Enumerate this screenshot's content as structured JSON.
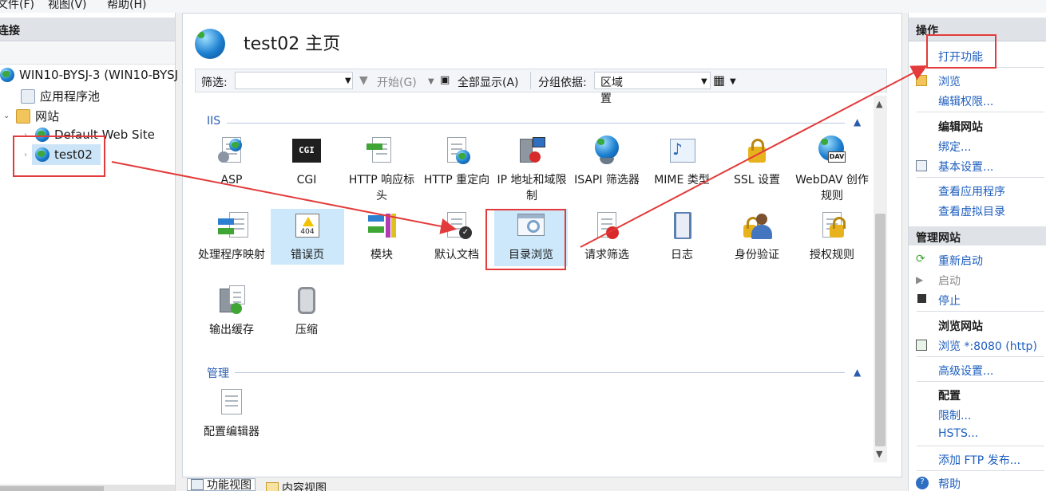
{
  "menu": {
    "items": [
      "文件(F)",
      "视图(V)",
      "帮助(H)"
    ]
  },
  "connections": {
    "header": "连接",
    "tree": {
      "server": "WIN10-BYSJ-3 (WIN10-BYSJ",
      "app_pools": "应用程序池",
      "sites": "网站",
      "default_site": "Default Web Site",
      "selected_site": "test02"
    }
  },
  "center": {
    "title": "test02 主页",
    "filter": {
      "label": "筛选:",
      "start": "开始(G)",
      "show_all": "全部显示(A)",
      "group_by_label": "分组依据:",
      "group_by_value": "区域",
      "overflow": "置"
    },
    "groups": {
      "iis": "IIS",
      "manage": "管理"
    },
    "features": [
      {
        "label": "ASP"
      },
      {
        "label": "CGI"
      },
      {
        "label": "HTTP 响应标头"
      },
      {
        "label": "HTTP 重定向"
      },
      {
        "label": "IP 地址和域限制"
      },
      {
        "label": "ISAPI 筛选器"
      },
      {
        "label": "MIME 类型"
      },
      {
        "label": "SSL 设置"
      },
      {
        "label": "WebDAV 创作规则"
      },
      {
        "label": "处理程序映射"
      },
      {
        "label": "错误页"
      },
      {
        "label": "模块"
      },
      {
        "label": "默认文档"
      },
      {
        "label": "目录浏览"
      },
      {
        "label": "请求筛选"
      },
      {
        "label": "日志"
      },
      {
        "label": "身份验证"
      },
      {
        "label": "授权规则"
      },
      {
        "label": "输出缓存"
      },
      {
        "label": "压缩"
      },
      {
        "label": "配置编辑器"
      }
    ],
    "icon_texts": {
      "cgi": "CGI",
      "err": "404",
      "dav": "DAV"
    },
    "bottom_tabs": {
      "features_view": "功能视图",
      "content_view": "内容视图"
    }
  },
  "actions": {
    "header": "操作",
    "open_feature": "打开功能",
    "browse": "浏览",
    "edit_permissions": "编辑权限...",
    "edit_site": "编辑网站",
    "bindings": "绑定...",
    "basic_settings": "基本设置...",
    "view_apps": "查看应用程序",
    "view_vdirs": "查看虚拟目录",
    "manage_site": "管理网站",
    "restart": "重新启动",
    "start": "启动",
    "stop": "停止",
    "browse_site": "浏览网站",
    "browse_8080": "浏览 *:8080 (http)",
    "advanced_settings": "高级设置...",
    "config": "配置",
    "limits": "限制...",
    "hsts": "HSTS...",
    "add_ftp": "添加 FTP 发布...",
    "help": "帮助"
  },
  "colors": {
    "annotation_red": "#e33b3b",
    "link_blue": "#1f5fbf",
    "selection_blue": "#cde8fb"
  }
}
